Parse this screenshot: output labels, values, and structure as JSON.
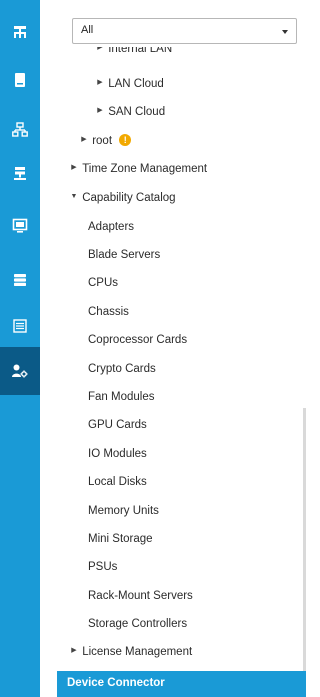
{
  "filter": {
    "value": "All"
  },
  "tree": {
    "clipped": {
      "label": "Internal LAN"
    },
    "items": [
      {
        "label": "LAN Cloud",
        "caret": "▶"
      },
      {
        "label": "SAN Cloud",
        "caret": "▶"
      },
      {
        "label": "root",
        "caret": "▶",
        "badge": "!"
      },
      {
        "label": "Time Zone Management",
        "caret": "▶"
      },
      {
        "label": "Capability Catalog",
        "caret": "▼"
      },
      {
        "label": "Adapters"
      },
      {
        "label": "Blade Servers"
      },
      {
        "label": "CPUs"
      },
      {
        "label": "Chassis"
      },
      {
        "label": "Coprocessor Cards"
      },
      {
        "label": "Crypto Cards"
      },
      {
        "label": "Fan Modules"
      },
      {
        "label": "GPU Cards"
      },
      {
        "label": "IO Modules"
      },
      {
        "label": "Local Disks"
      },
      {
        "label": "Memory Units"
      },
      {
        "label": "Mini Storage"
      },
      {
        "label": "PSUs"
      },
      {
        "label": "Rack-Mount Servers"
      },
      {
        "label": "Storage Controllers"
      },
      {
        "label": "License Management",
        "caret": "▶"
      }
    ],
    "selected": {
      "label": "Device Connector"
    }
  },
  "rail": {
    "items": [
      {
        "icon": "equipment-icon"
      },
      {
        "icon": "server-icon"
      },
      {
        "icon": "lan-icon"
      },
      {
        "icon": "san-icon"
      },
      {
        "icon": "vm-icon"
      },
      {
        "icon": "storage-icon"
      },
      {
        "icon": "chassis-icon"
      },
      {
        "icon": "admin-icon",
        "active": true
      }
    ]
  },
  "colors": {
    "rail": "#1a9ad6",
    "rail_active": "#0b5a87",
    "selected": "#1a9ad6",
    "warn": "#f2a900"
  }
}
